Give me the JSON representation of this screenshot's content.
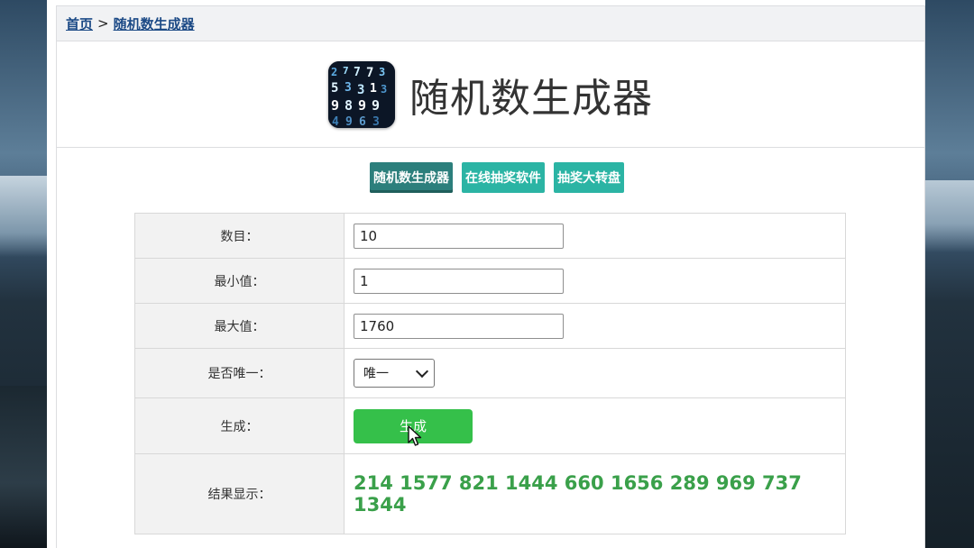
{
  "breadcrumb": {
    "home_label": "首页",
    "separator": ">",
    "current_label": "随机数生成器"
  },
  "header": {
    "title": "随机数生成器",
    "logo_icon": "matrix-numbers-icon"
  },
  "nav": {
    "items": [
      {
        "label": "随机数生成器",
        "active": true
      },
      {
        "label": "在线抽奖软件",
        "active": false
      },
      {
        "label": "抽奖大转盘",
        "active": false
      }
    ]
  },
  "form": {
    "count_label": "数目：",
    "count_value": "10",
    "min_label": "最小值：",
    "min_value": "1",
    "max_label": "最大值：",
    "max_value": "1760",
    "unique_label": "是否唯一：",
    "unique_selected": "唯一",
    "generate_label": "生成：",
    "generate_button": "生成",
    "result_label": "结果显示：",
    "result_value": "214 1577 821 1444 660 1656 289 969 737 1344"
  },
  "colors": {
    "breadcrumb_link": "#1c4a86",
    "nav_active": "#2c7f7c",
    "nav_inactive": "#2bb4a4",
    "generate_button": "#35c04a",
    "result_text": "#3aa04a"
  }
}
